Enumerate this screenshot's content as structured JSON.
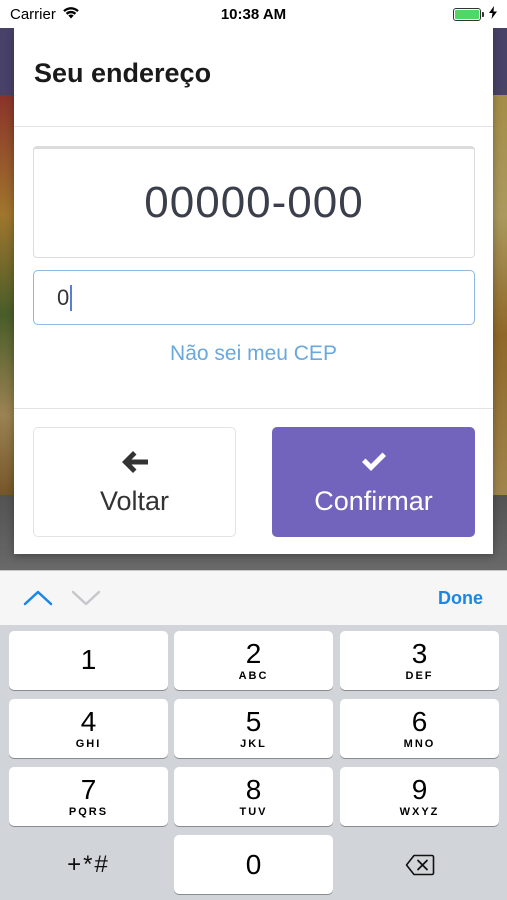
{
  "status_bar": {
    "carrier": "Carrier",
    "time": "10:38 AM"
  },
  "modal": {
    "title": "Seu endereço",
    "cep_display": "00000-000",
    "cep_input_value": "0",
    "forgot_cep_link": "Não sei meu CEP",
    "back_button": {
      "label": "Voltar",
      "icon": "arrow-left-icon"
    },
    "confirm_button": {
      "label": "Confirmar",
      "icon": "checkmark-icon"
    },
    "accent_color": "#7264bd"
  },
  "keyboard": {
    "done_label": "Done",
    "keys": [
      {
        "num": "1",
        "letters": ""
      },
      {
        "num": "2",
        "letters": "ABC"
      },
      {
        "num": "3",
        "letters": "DEF"
      },
      {
        "num": "4",
        "letters": "GHI"
      },
      {
        "num": "5",
        "letters": "JKL"
      },
      {
        "num": "6",
        "letters": "MNO"
      },
      {
        "num": "7",
        "letters": "PQRS"
      },
      {
        "num": "8",
        "letters": "TUV"
      },
      {
        "num": "9",
        "letters": "WXYZ"
      }
    ],
    "symbols_key": "+*#",
    "zero_key": "0"
  }
}
